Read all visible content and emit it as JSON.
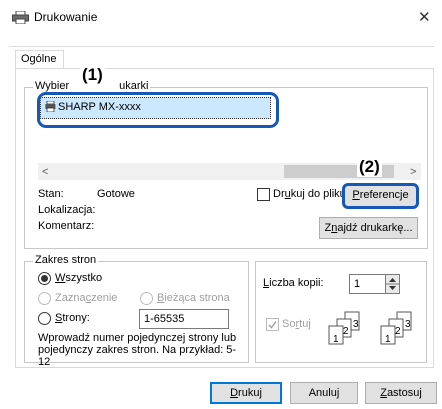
{
  "window": {
    "title": "Drukowanie",
    "close_glyph": "✕"
  },
  "tabs": [
    {
      "label": "Ogólne"
    }
  ],
  "printer_group": {
    "legend_start": "Wybier",
    "legend_end": "ukarki"
  },
  "printer_list": {
    "items": [
      {
        "name": "SHARP MX-xxxx",
        "selected": true
      }
    ]
  },
  "callouts": {
    "one": "(1)",
    "two": "(2)"
  },
  "scroll": {
    "left": "<",
    "right": ">"
  },
  "status": {
    "state_label": "Stan:",
    "state_value": "Gotowe",
    "location_label": "Lokalizacja:",
    "comment_label": "Komentarz:"
  },
  "print_to_file": {
    "label_pre": "Dr",
    "label_ul": "u",
    "label_post": "kuj do pliku",
    "checked": false
  },
  "buttons": {
    "preferences": {
      "ul": "P",
      "rest": "referencje"
    },
    "find_printer": {
      "pre": "Z",
      "ul": "n",
      "post": "ajdź drukarkę..."
    },
    "print": {
      "ul": "D",
      "rest": "rukuj"
    },
    "cancel": "Anuluj",
    "apply": {
      "ul": "Z",
      "rest": "astosuj"
    }
  },
  "page_range": {
    "legend": "Zakres stron",
    "all": {
      "ul": "W",
      "rest": "szystko",
      "checked": true
    },
    "selection": {
      "pre": "Zazna",
      "ul": "c",
      "post": "zenie"
    },
    "current": {
      "ul": "B",
      "rest": "ieżąca strona"
    },
    "pages": {
      "ul": "S",
      "rest": "trony:"
    },
    "pages_value": "1-65535",
    "hint": "Wprowadź numer pojedynczej strony lub pojedynczy zakres stron. Na przykład: 5-12"
  },
  "copies": {
    "label_pre": "",
    "label_ul": "L",
    "label_post": "iczba kopii:",
    "value": "1",
    "collate": {
      "pre": "So",
      "ul": "r",
      "post": "tuj",
      "checked": true
    },
    "illustration": [
      "1",
      "2",
      "3",
      "1",
      "2",
      "3"
    ]
  },
  "icons": {
    "window": "printer-icon",
    "printer": "printer-icon",
    "spin": "spin-arrows-icon"
  }
}
